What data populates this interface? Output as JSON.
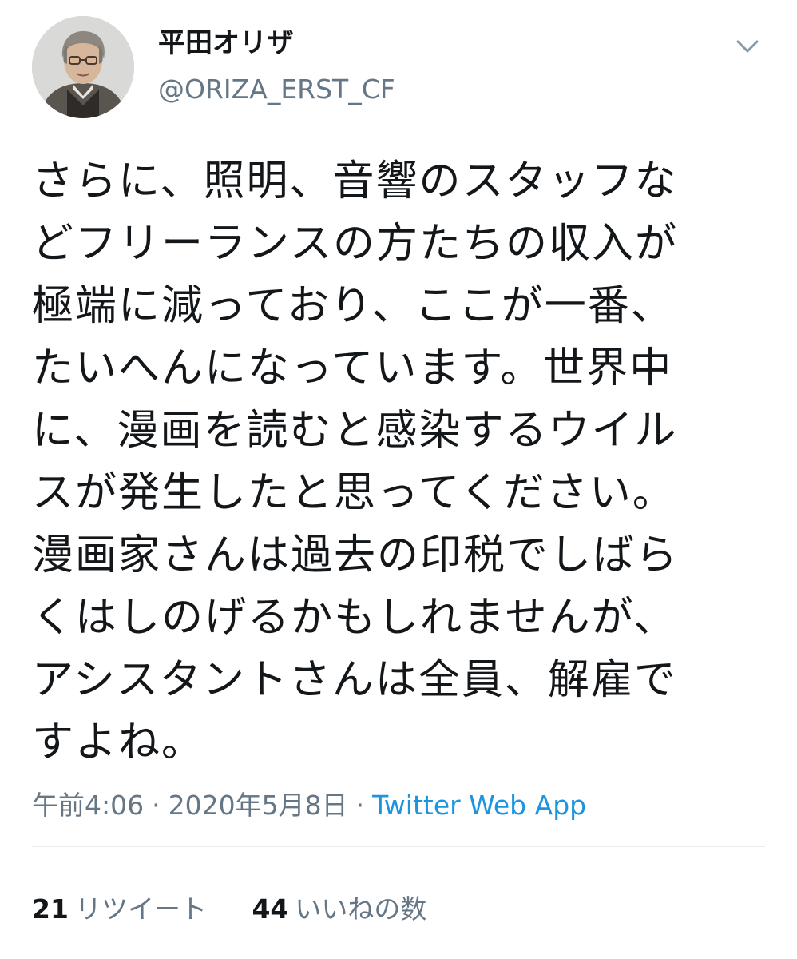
{
  "user": {
    "display_name": "平田オリザ",
    "handle": "@ORIZA_ERST_CF",
    "avatar_icon": "user-avatar-photo"
  },
  "menu_icon": "chevron-down-icon",
  "tweet": {
    "lines": [
      "さらに、照明、音響のスタッフな",
      "どフリーランスの方たちの収入が",
      "極端に減っており、ここが一番、",
      "たいへんになっています。世界中",
      "に、漫画を読むと感染するウイル",
      "スが発生したと思ってください。",
      "漫画家さんは過去の印税でしばら",
      "くはしのげるかもしれませんが、",
      "アシスタントさんは全員、解雇で",
      "すよね。"
    ]
  },
  "meta": {
    "time": "午前4:06",
    "separator": "·",
    "date": "2020年5月8日",
    "source": "Twitter Web App"
  },
  "stats": {
    "retweets_count": "21",
    "retweets_label": "リツイート",
    "likes_count": "44",
    "likes_label": "いいねの数"
  },
  "colors": {
    "text": "#14171a",
    "secondary": "#657786",
    "link": "#1b95e0",
    "divider": "#e6ecf0"
  }
}
